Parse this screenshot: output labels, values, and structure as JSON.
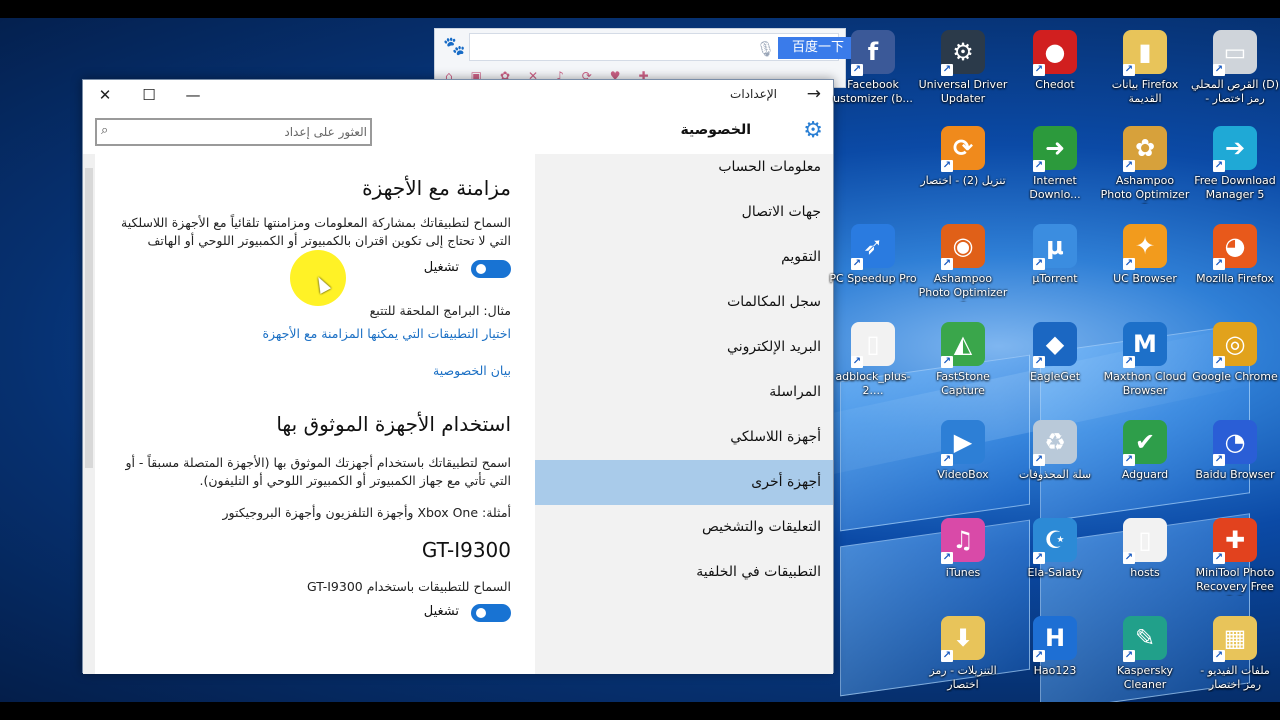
{
  "browser": {
    "go_label": "百度一下",
    "search_value": ""
  },
  "settings": {
    "window_title": "الإعدادات",
    "page_title": "الخصوصية",
    "find_placeholder": "العثور على إعداد",
    "nav": [
      "معلومات الحساب",
      "جهات الاتصال",
      "التقويم",
      "سجل المكالمات",
      "البريد الإلكتروني",
      "المراسلة",
      "أجهزة اللاسلكي",
      "أجهزة أخرى",
      "التعليقات والتشخيص",
      "التطبيقات في الخلفية"
    ],
    "active_nav": "أجهزة أخرى",
    "sync": {
      "heading": "مزامنة مع الأجهزة",
      "description": "السماح لتطبيقاتك بمشاركة المعلومات ومزامنتها تلقائياً مع الأجهزة اللاسلكية التي لا تحتاج إلى تكوين اقتران بالكمبيوتر أو الكمبيوتر اللوحي أو الهاتف",
      "toggle_label": "تشغيل",
      "example": "مثال: البرامج الملحقة للتتبع",
      "choose_apps_link": "اختيار التطبيقات التي يمكنها المزامنة مع الأجهزة",
      "privacy_link": "بيان الخصوصية"
    },
    "trusted": {
      "heading": "استخدام الأجهزة الموثوق بها",
      "description": "اسمح لتطبيقاتك باستخدام أجهزتك الموثوق بها (الأجهزة المتصلة مسبقاً - أو التي تأتي مع جهاز الكمبيوتر أو الكمبيوتر اللوحي أو التليفون).",
      "examples": "أمثلة: Xbox One وأجهزة التلفزيون وأجهزة البروجيكتور",
      "device_name": "GT-I9300",
      "allow_label": "السماح للتطبيقات باستخدام GT-I9300",
      "toggle_label": "تشغيل"
    }
  },
  "desktop_icons": [
    {
      "label": "Facebook ustomizer (b...",
      "glyph": "f",
      "color": "#3b5998"
    },
    {
      "label": "Universal Driver Updater",
      "glyph": "⚙",
      "color": "#2b3a4a"
    },
    {
      "label": "Chedot",
      "glyph": "●",
      "color": "#d11f1f"
    },
    {
      "label": "بيانات Firefox القديمة",
      "glyph": "▮",
      "color": "#e8c45a"
    },
    {
      "label": "القرص المحلي (D) - رمز اختصار",
      "glyph": "▭",
      "color": "#cfd4da"
    },
    {
      "label": "تنزيل (2) - اختصار",
      "glyph": "⟳",
      "color": "#f08a1c"
    },
    {
      "label": "Internet Downlo...",
      "glyph": "➜",
      "color": "#2c9a3c"
    },
    {
      "label": "Ashampoo Photo Optimizer 5",
      "glyph": "✿",
      "color": "#d7a13b"
    },
    {
      "label": "Free Download Manager 5",
      "glyph": "➔",
      "color": "#1fa9d6"
    },
    {
      "label": "PC Speedup Pro",
      "glyph": "➶",
      "color": "#2a7be0"
    },
    {
      "label": "Ashampoo Photo Optimizer 6",
      "glyph": "◉",
      "color": "#e06018"
    },
    {
      "label": "μTorrent",
      "glyph": "μ",
      "color": "#3b8de0"
    },
    {
      "label": "UC Browser",
      "glyph": "✦",
      "color": "#f29b1d"
    },
    {
      "label": "Mozilla Firefox",
      "glyph": "◕",
      "color": "#e8591b"
    },
    {
      "label": "adblock_plus-2....",
      "glyph": "▯",
      "color": "#f2f2f2"
    },
    {
      "label": "FastStone Capture",
      "glyph": "◭",
      "color": "#3aa64b"
    },
    {
      "label": "EagleGet",
      "glyph": "◆",
      "color": "#1b67c2"
    },
    {
      "label": "Maxthon Cloud Browser",
      "glyph": "M",
      "color": "#1d70c9"
    },
    {
      "label": "Google Chrome",
      "glyph": "◎",
      "color": "#e1a21c"
    },
    {
      "label": "VideoBox",
      "glyph": "▶",
      "color": "#2d7fd6"
    },
    {
      "label": "سلة المحذوفات",
      "glyph": "♻",
      "color": "#b9c9d9"
    },
    {
      "label": "Adguard",
      "glyph": "✔",
      "color": "#2e9e4a"
    },
    {
      "label": "Baidu Browser",
      "glyph": "◔",
      "color": "#2a5ed6"
    },
    {
      "label": "iTunes",
      "glyph": "♫",
      "color": "#d94aa8"
    },
    {
      "label": "Ela-Salaty",
      "glyph": "☪",
      "color": "#2c8ad6"
    },
    {
      "label": "hosts",
      "glyph": "▯",
      "color": "#f2f2f2"
    },
    {
      "label": "MiniTool Photo Recovery Free 2.0",
      "glyph": "✚",
      "color": "#e2421e"
    },
    {
      "label": "التنزيلات - رمز اختصار",
      "glyph": "⬇",
      "color": "#e8c45a"
    },
    {
      "label": "Hao123",
      "glyph": "H",
      "color": "#1e6fd4"
    },
    {
      "label": "Kaspersky Cleaner",
      "glyph": "✎",
      "color": "#21a08a"
    },
    {
      "label": "ملفات الفيديو - رمز اختصار",
      "glyph": "▦",
      "color": "#e8c45a"
    }
  ]
}
